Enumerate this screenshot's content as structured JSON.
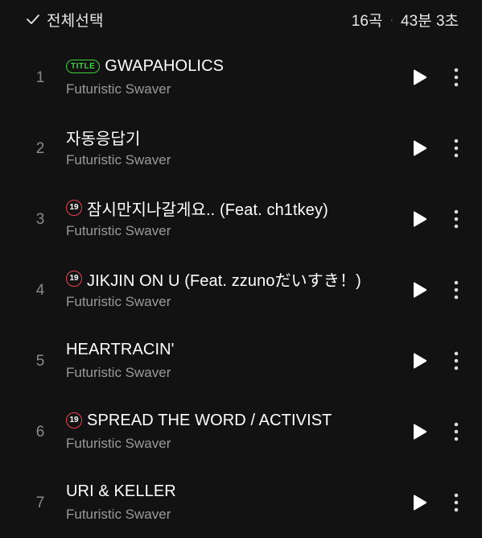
{
  "header": {
    "select_all_label": "전체선택",
    "track_count": "16곡",
    "separator": "·",
    "total_duration": "43분 3초"
  },
  "badges": {
    "title_badge": "TITLE",
    "age_badge": "19"
  },
  "colors": {
    "background": "#121212",
    "title_badge": "#3dd13d",
    "age_badge_border": "#e8434b"
  },
  "tracks": [
    {
      "number": "1",
      "title": "GWAPAHOLICS",
      "artist": "Futuristic Swaver",
      "is_title": true,
      "explicit": false
    },
    {
      "number": "2",
      "title": "자동응답기",
      "artist": "Futuristic Swaver",
      "is_title": false,
      "explicit": false
    },
    {
      "number": "3",
      "title": "잠시만지나갈게요.. (Feat. ch1tkey)",
      "artist": "Futuristic Swaver",
      "is_title": false,
      "explicit": true
    },
    {
      "number": "4",
      "title": "JIKJIN ON U (Feat. zzunoだいすき！)",
      "artist": "Futuristic Swaver",
      "is_title": false,
      "explicit": true
    },
    {
      "number": "5",
      "title": "HEARTRACIN'",
      "artist": "Futuristic Swaver",
      "is_title": false,
      "explicit": false
    },
    {
      "number": "6",
      "title": "SPREAD THE WORD / ACTIVIST",
      "artist": "Futuristic Swaver",
      "is_title": false,
      "explicit": true
    },
    {
      "number": "7",
      "title": "URI & KELLER",
      "artist": "Futuristic Swaver",
      "is_title": false,
      "explicit": false
    }
  ],
  "icons": {
    "check": "check-icon",
    "play": "play-icon",
    "more": "more-vertical-icon"
  }
}
